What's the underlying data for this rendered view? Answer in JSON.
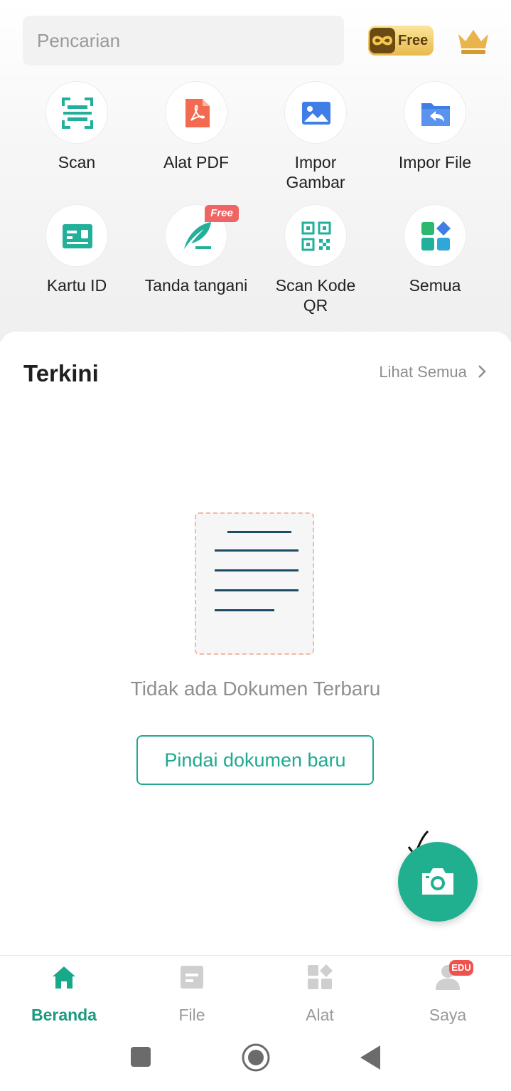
{
  "search": {
    "placeholder": "Pencarian"
  },
  "header": {
    "free_badge": "Free",
    "icons": [
      "infinity-icon",
      "crown-icon"
    ]
  },
  "tools": [
    {
      "label": "Scan",
      "icon": "scan-icon"
    },
    {
      "label": "Alat PDF",
      "icon": "pdf-icon"
    },
    {
      "label": "Impor\nGambar",
      "icon": "image-icon"
    },
    {
      "label": "Impor File",
      "icon": "folder-import-icon"
    },
    {
      "label": "Kartu ID",
      "icon": "id-card-icon"
    },
    {
      "label": "Tanda tangani",
      "icon": "signature-icon",
      "tag": "Free"
    },
    {
      "label": "Scan Kode\nQR",
      "icon": "qr-code-icon"
    },
    {
      "label": "Semua",
      "icon": "all-apps-icon"
    }
  ],
  "recent": {
    "title": "Terkini",
    "see_all": "Lihat Semua",
    "empty_text": "Tidak ada Dokumen Terbaru",
    "scan_button": "Pindai dokumen baru"
  },
  "bottom_nav": [
    {
      "label": "Beranda",
      "icon": "home-icon",
      "active": true
    },
    {
      "label": "File",
      "icon": "file-icon",
      "active": false
    },
    {
      "label": "Alat",
      "icon": "tools-icon",
      "active": false
    },
    {
      "label": "Saya",
      "icon": "profile-icon",
      "active": false,
      "badge": "EDU"
    }
  ],
  "colors": {
    "accent": "#1fa98f",
    "fab": "#21b08f",
    "badge": "#ef5350"
  }
}
